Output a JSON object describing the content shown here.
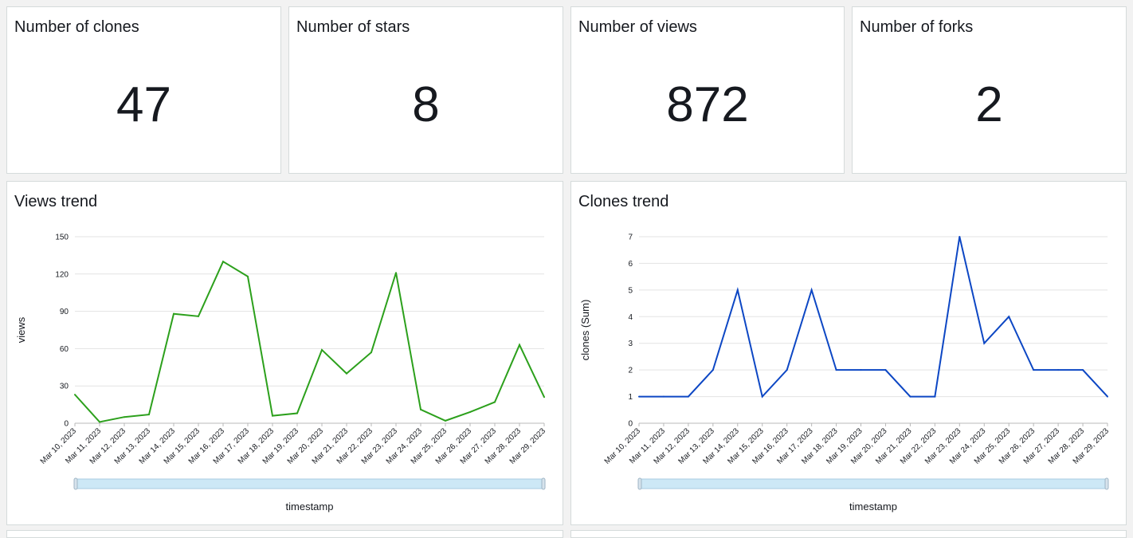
{
  "kpis": [
    {
      "title": "Number of clones",
      "value": "47"
    },
    {
      "title": "Number of stars",
      "value": "8"
    },
    {
      "title": "Number of views",
      "value": "872"
    },
    {
      "title": "Number of forks",
      "value": "2"
    }
  ],
  "charts": [
    {
      "title": "Views trend"
    },
    {
      "title": "Clones trend"
    }
  ],
  "chart_data": [
    {
      "type": "line",
      "title": "Views trend",
      "xlabel": "timestamp",
      "ylabel": "views",
      "color": "#2ca01c",
      "ylim": [
        0,
        150
      ],
      "yticks": [
        0,
        30,
        60,
        90,
        120,
        150
      ],
      "x": [
        "Mar 10, 2023",
        "Mar 11, 2023",
        "Mar 12, 2023",
        "Mar 13, 2023",
        "Mar 14, 2023",
        "Mar 15, 2023",
        "Mar 16, 2023",
        "Mar 17, 2023",
        "Mar 18, 2023",
        "Mar 19, 2023",
        "Mar 20, 2023",
        "Mar 21, 2023",
        "Mar 22, 2023",
        "Mar 23, 2023",
        "Mar 24, 2023",
        "Mar 25, 2023",
        "Mar 26, 2023",
        "Mar 27, 2023",
        "Mar 28, 2023",
        "Mar 29, 2023"
      ],
      "values": [
        23,
        1,
        5,
        7,
        88,
        86,
        130,
        118,
        6,
        8,
        59,
        40,
        57,
        121,
        11,
        2,
        9,
        17,
        63,
        21
      ],
      "grid": true
    },
    {
      "type": "line",
      "title": "Clones trend",
      "xlabel": "timestamp",
      "ylabel": "clones (Sum)",
      "color": "#0d47c4",
      "ylim": [
        0,
        7
      ],
      "yticks": [
        0,
        1,
        2,
        3,
        4,
        5,
        6,
        7
      ],
      "x": [
        "Mar 10, 2023",
        "Mar 11, 2023",
        "Mar 12, 2023",
        "Mar 13, 2023",
        "Mar 14, 2023",
        "Mar 15, 2023",
        "Mar 16, 2023",
        "Mar 17, 2023",
        "Mar 18, 2023",
        "Mar 19, 2023",
        "Mar 20, 2023",
        "Mar 21, 2023",
        "Mar 22, 2023",
        "Mar 23, 2023",
        "Mar 24, 2023",
        "Mar 25, 2023",
        "Mar 26, 2023",
        "Mar 27, 2023",
        "Mar 28, 2023",
        "Mar 29, 2023"
      ],
      "values": [
        1,
        1,
        1,
        2,
        5,
        1,
        2,
        5,
        2,
        2,
        2,
        1,
        1,
        7,
        3,
        4,
        2,
        2,
        2,
        1
      ],
      "grid": true
    }
  ]
}
